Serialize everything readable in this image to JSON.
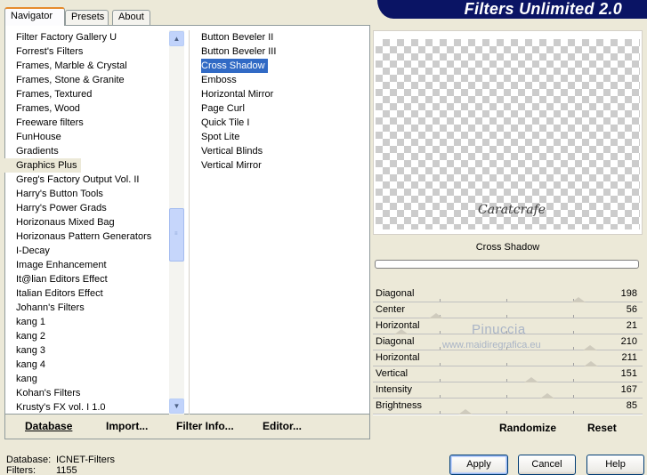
{
  "app": {
    "title": "Filters Unlimited 2.0"
  },
  "tabs": [
    {
      "label": "Navigator",
      "active": true
    },
    {
      "label": "Presets",
      "active": false
    },
    {
      "label": "About",
      "active": false
    }
  ],
  "categories": [
    "Filter Factory Gallery U",
    "Forrest's Filters",
    "Frames, Marble & Crystal",
    "Frames, Stone & Granite",
    "Frames, Textured",
    "Frames, Wood",
    "Freeware filters",
    "FunHouse",
    "Gradients",
    "Graphics Plus",
    "Greg's Factory Output Vol. II",
    "Harry's Button Tools",
    "Harry's Power Grads",
    "Horizonaus Mixed Bag",
    "Horizonaus Pattern Generators",
    "I-Decay",
    "Image Enhancement",
    "It@lian Editors Effect",
    "Italian Editors Effect",
    "Johann's Filters",
    "kang 1",
    "kang 2",
    "kang 3",
    "kang 4",
    "kang",
    "Kohan's Filters",
    "Krusty's FX vol. I 1.0"
  ],
  "selected_category": "Graphics Plus",
  "filters": [
    "Button Beveler II",
    "Button Beveler III",
    "Cross Shadow",
    "Emboss",
    "Horizontal Mirror",
    "Page Curl",
    "Quick Tile I",
    "Spot Lite",
    "Vertical Blinds",
    "Vertical Mirror"
  ],
  "selected_filter": "Cross Shadow",
  "nav_buttons": {
    "database": "Database",
    "import": "Import...",
    "filter_info": "Filter Info...",
    "editor": "Editor..."
  },
  "preview": {
    "signature": "Caratcrafe",
    "effect_name": "Cross Shadow"
  },
  "sliders": [
    {
      "label": "Diagonal",
      "value": 198
    },
    {
      "label": "Center",
      "value": 56
    },
    {
      "label": "Horizontal",
      "value": 21
    },
    {
      "label": "Diagonal",
      "value": 210
    },
    {
      "label": "Horizontal",
      "value": 211
    },
    {
      "label": "Vertical",
      "value": 151
    },
    {
      "label": "Intensity",
      "value": 167
    },
    {
      "label": "Brightness",
      "value": 85
    }
  ],
  "watermark": {
    "line1": "Pinuccia",
    "line2": "www.maidiregrafica.eu"
  },
  "right_buttons": {
    "randomize": "Randomize",
    "reset": "Reset"
  },
  "footer": {
    "database_label": "Database:",
    "database_value": "ICNET-Filters",
    "filters_label": "Filters:",
    "filters_value": "1155"
  },
  "dialog_buttons": {
    "apply": "Apply",
    "cancel": "Cancel",
    "help": "Help"
  }
}
